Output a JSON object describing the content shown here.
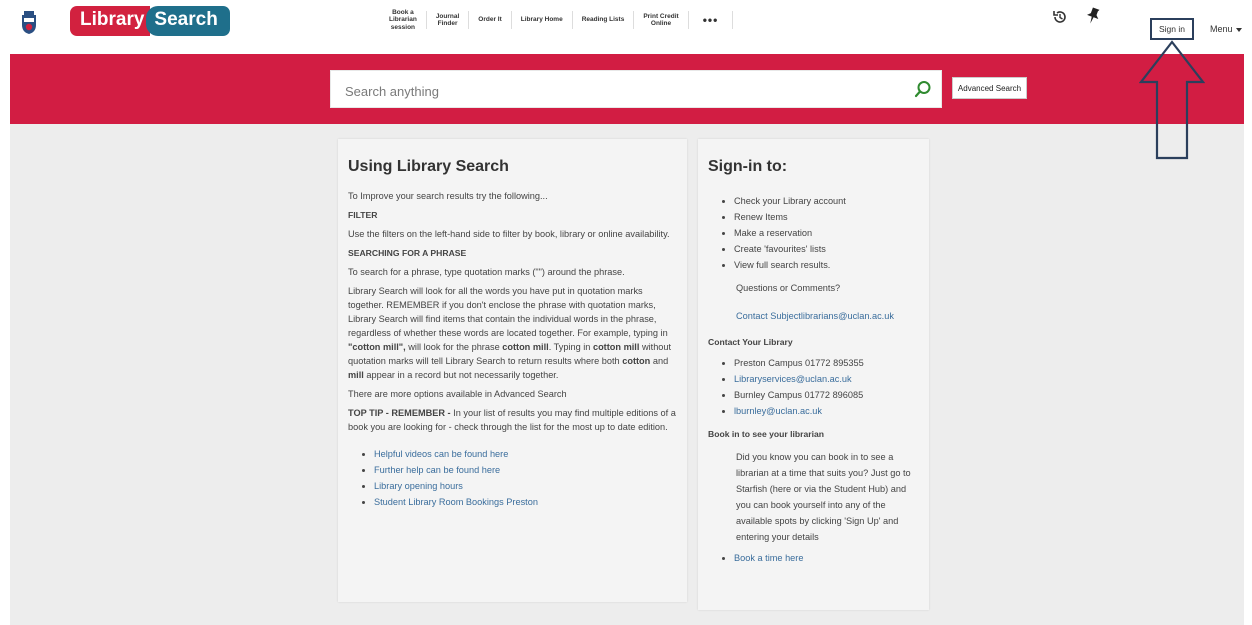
{
  "header": {
    "logo": {
      "part1": "Library",
      "part2": "Search"
    },
    "nav": [
      {
        "label": "Book a\nLibrarian\nsession"
      },
      {
        "label": "Journal\nFinder"
      },
      {
        "label": "Order It"
      },
      {
        "label": "Library Home"
      },
      {
        "label": "Reading Lists"
      },
      {
        "label": "Print Credit\nOnline"
      }
    ],
    "more_label": "•••",
    "history_icon": "history-icon",
    "pin_icon": "pin-icon",
    "signin_label": "Sign in",
    "menu_label": "Menu"
  },
  "search": {
    "placeholder": "Search anything",
    "value": "",
    "advanced_label": "Advanced Search"
  },
  "colors": {
    "brand_red": "#d21d43",
    "logo_teal": "#1f6f8b",
    "link": "#3a6d9c",
    "annotation": "#2b3f5c"
  },
  "using": {
    "title": "Using Library Search",
    "intro": "To Improve your search results try the following...",
    "filter_head": "FILTER",
    "filter_text": "Use the filters on the left-hand side to filter by book, library or online availability.",
    "phrase_head": "SEARCHING FOR A PHRASE",
    "phrase_text": "To search for a phrase, type quotation marks (\"\") around the phrase.",
    "p_a": "Library Search will look for all the words you have put in quotation marks together. REMEMBER if you don't enclose the phrase with quotation marks, Library Search will find items that contain the individual words in the phrase, regardless of whether these words are located together. For example, typing in ",
    "p_b": "\"cotton mill\",",
    "p_c": " will look for the phrase ",
    "p_d": "cotton mill",
    "p_e": ". Typing in ",
    "p_f": "cotton mill",
    "p_g": " without quotation marks will tell Library Search to return results where both ",
    "p_h": "cotton",
    "p_i": " and ",
    "p_j": "mill",
    "p_k": " appear in a record but not necessarily together.",
    "adv_text": "There are more options available in Advanced Search",
    "tip_head": "TOP TIP - REMEMBER - ",
    "tip_text": "In your list of results you may find multiple editions of a book you are looking for - check through the list for the most up to date edition.",
    "links": [
      "Helpful videos can be found here",
      "Further help can be found here",
      "Library opening hours",
      "Student Library Room Bookings Preston"
    ]
  },
  "signin_card": {
    "title": "Sign-in to:",
    "items": [
      "Check your Library account",
      "Renew Items",
      "Make a reservation",
      "Create 'favourites' lists",
      "View full search results."
    ],
    "questions": "Questions or Comments?",
    "contact_link": "Contact Subjectlibrarians@uclan.ac.uk",
    "contact_head": "Contact Your Library",
    "contacts": [
      {
        "text": "Preston Campus 01772 895355",
        "link": false
      },
      {
        "text": "Libraryservices@uclan.ac.uk",
        "link": true
      },
      {
        "text": "Burnley Campus 01772 896085",
        "link": false
      },
      {
        "text": "lburnley@uclan.ac.uk",
        "link": true
      }
    ],
    "book_head": "Book in to see your librarian",
    "book_text": "Did you know you can book in to see a librarian at a time that suits you? Just go to Starfish (here or via the Student Hub) and you can book yourself into any of the available spots by clicking 'Sign Up' and entering your details",
    "book_link": "Book a time here"
  }
}
